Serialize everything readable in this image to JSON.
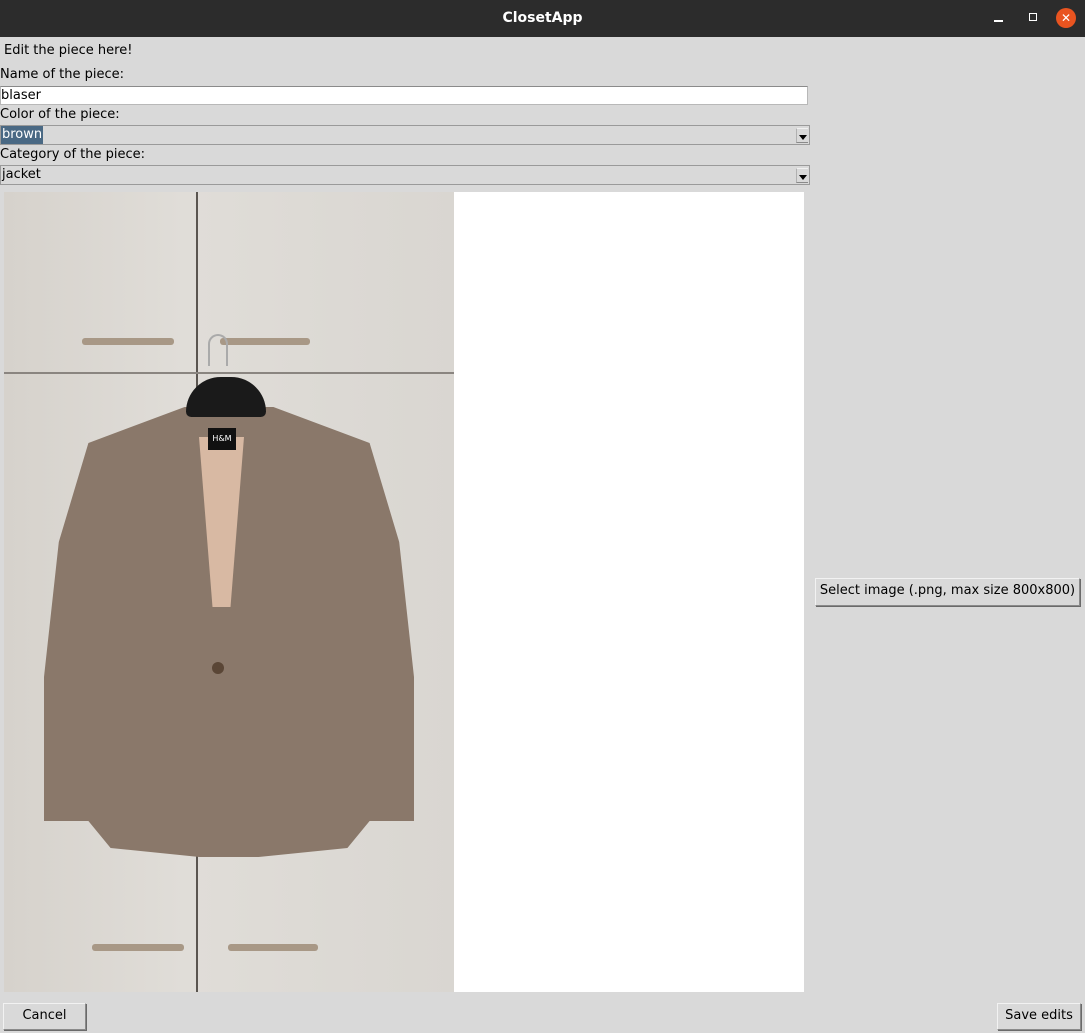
{
  "window": {
    "title": "ClosetApp",
    "controls": {
      "minimize": "minimize-icon",
      "maximize": "maximize-icon",
      "close": "close-icon"
    }
  },
  "form": {
    "heading": "Edit the piece here!",
    "name_label": "Name of the piece:",
    "name_value": "blaser",
    "color_label": "Color of the piece:",
    "color_value": "brown",
    "category_label": "Category of the piece:",
    "category_value": "jacket"
  },
  "image_panel": {
    "photo_tag_text": "H&M",
    "select_image_label": "Select image (.png, max size 800x800)"
  },
  "footer": {
    "cancel_label": "Cancel",
    "save_label": "Save edits"
  },
  "colors": {
    "titlebar": "#2c2c2c",
    "window_bg": "#d9d9d9",
    "close_button": "#e95420",
    "selection": "#4a6984"
  }
}
